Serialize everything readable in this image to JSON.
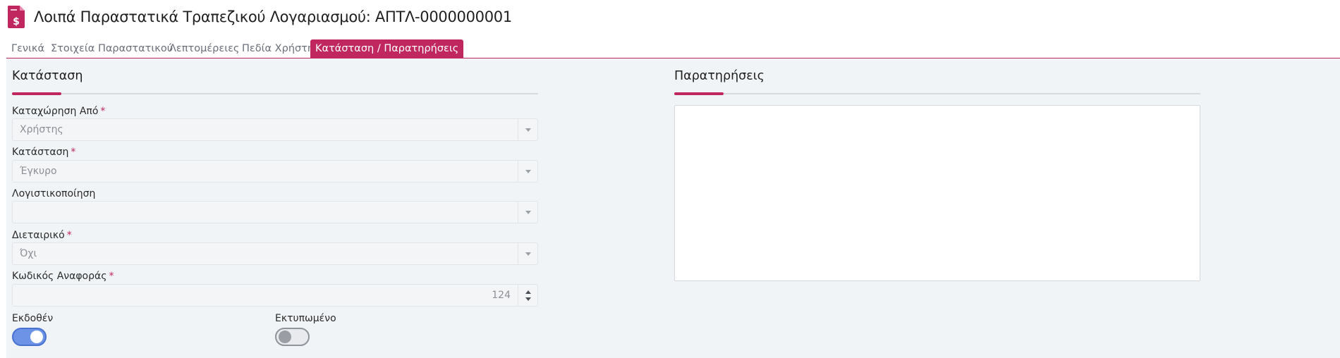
{
  "header": {
    "title": "Λοιπά Παραστατικά Τραπεζικού Λογαριασμού: ΑΠΤΛ-0000000001",
    "icon": "document-money-icon",
    "accent_color": "#c0275f"
  },
  "tabs": [
    {
      "label": "Γενικά"
    },
    {
      "label": "Στοιχεία Παραστατικού"
    },
    {
      "label": "Λεπτομέρειες"
    },
    {
      "label": "Πεδία Χρήστη"
    },
    {
      "label": "Κατάσταση / Παρατηρήσεις",
      "active": true
    }
  ],
  "status_section": {
    "title": "Κατάσταση",
    "fields": {
      "registered_by": {
        "label": "Καταχώρηση Από",
        "required": "*",
        "value": "Χρήστης"
      },
      "status": {
        "label": "Κατάσταση",
        "required": "*",
        "value": "Έγκυρο"
      },
      "accounting": {
        "label": "Λογιστικοποίηση",
        "value": ""
      },
      "intercompany": {
        "label": "Διεταιρικό",
        "required": "*",
        "value": "Όχι"
      },
      "reference_code": {
        "label": "Κωδικός Αναφοράς",
        "required": "*",
        "value": "124"
      }
    },
    "toggles": {
      "issued": {
        "label": "Εκδοθέν",
        "on": true
      },
      "printed": {
        "label": "Εκτυπωμένο",
        "on": false
      }
    }
  },
  "notes_section": {
    "title": "Παρατηρήσεις",
    "value": ""
  }
}
